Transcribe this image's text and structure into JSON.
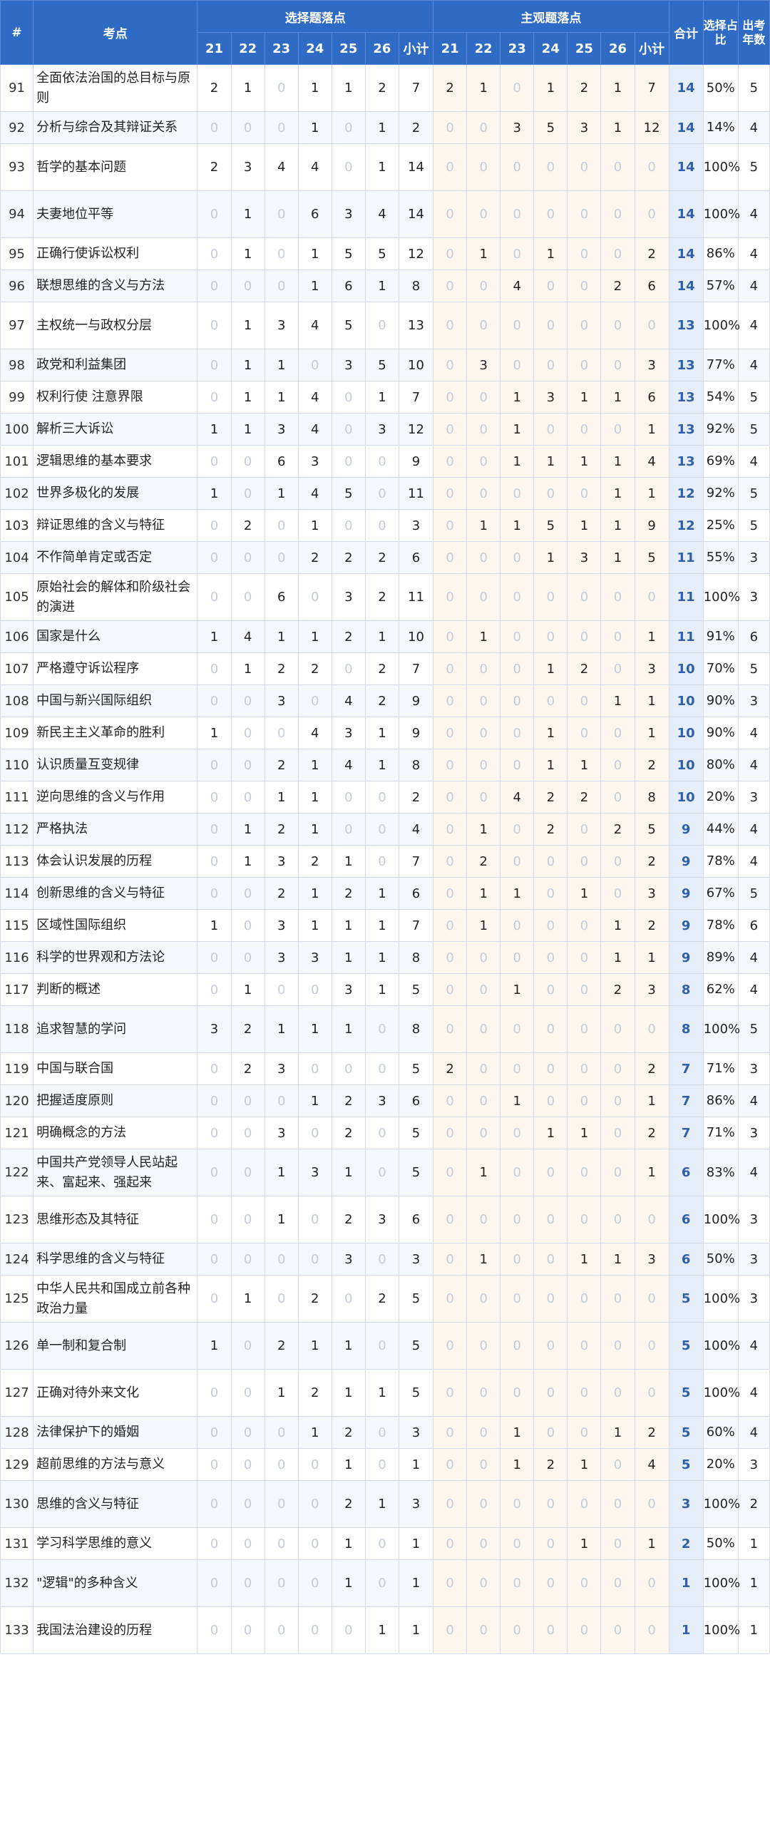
{
  "header": {
    "idx": "#",
    "topic": "考点",
    "objective_group": "选择题落点",
    "subjective_group": "主观题落点",
    "total": "合计",
    "ratio": "选择占比",
    "years": "出考年数",
    "year_cols": [
      "21",
      "22",
      "23",
      "24",
      "25",
      "26"
    ],
    "subtotal": "小计"
  },
  "rows": [
    {
      "no": "91",
      "topic": "全面依法治国的总目标与原则",
      "obj": [
        "2",
        "1",
        "0",
        "1",
        "1",
        "2"
      ],
      "obj_sub": "7",
      "subj": [
        "2",
        "1",
        "0",
        "1",
        "2",
        "1"
      ],
      "subj_sub": "7",
      "total": "14",
      "ratio": "50%",
      "years": "5"
    },
    {
      "no": "92",
      "topic": "分析与综合及其辩证关系",
      "obj": [
        "0",
        "0",
        "0",
        "1",
        "0",
        "1"
      ],
      "obj_sub": "2",
      "subj": [
        "0",
        "0",
        "3",
        "5",
        "3",
        "1"
      ],
      "subj_sub": "12",
      "total": "14",
      "ratio": "14%",
      "years": "4"
    },
    {
      "no": "93",
      "topic": "哲学的基本问题",
      "obj": [
        "2",
        "3",
        "4",
        "4",
        "0",
        "1"
      ],
      "obj_sub": "14",
      "subj": [
        "0",
        "0",
        "0",
        "0",
        "0",
        "0"
      ],
      "subj_sub": "0",
      "total": "14",
      "ratio": "100%",
      "years": "5"
    },
    {
      "no": "94",
      "topic": "夫妻地位平等",
      "obj": [
        "0",
        "1",
        "0",
        "6",
        "3",
        "4"
      ],
      "obj_sub": "14",
      "subj": [
        "0",
        "0",
        "0",
        "0",
        "0",
        "0"
      ],
      "subj_sub": "0",
      "total": "14",
      "ratio": "100%",
      "years": "4"
    },
    {
      "no": "95",
      "topic": "正确行使诉讼权利",
      "obj": [
        "0",
        "1",
        "0",
        "1",
        "5",
        "5"
      ],
      "obj_sub": "12",
      "subj": [
        "0",
        "1",
        "0",
        "1",
        "0",
        "0"
      ],
      "subj_sub": "2",
      "total": "14",
      "ratio": "86%",
      "years": "4"
    },
    {
      "no": "96",
      "topic": "联想思维的含义与方法",
      "obj": [
        "0",
        "0",
        "0",
        "1",
        "6",
        "1"
      ],
      "obj_sub": "8",
      "subj": [
        "0",
        "0",
        "4",
        "0",
        "0",
        "2"
      ],
      "subj_sub": "6",
      "total": "14",
      "ratio": "57%",
      "years": "4"
    },
    {
      "no": "97",
      "topic": "主权统一与政权分层",
      "obj": [
        "0",
        "1",
        "3",
        "4",
        "5",
        "0"
      ],
      "obj_sub": "13",
      "subj": [
        "0",
        "0",
        "0",
        "0",
        "0",
        "0"
      ],
      "subj_sub": "0",
      "total": "13",
      "ratio": "100%",
      "years": "4"
    },
    {
      "no": "98",
      "topic": "政党和利益集团",
      "obj": [
        "0",
        "1",
        "1",
        "0",
        "3",
        "5"
      ],
      "obj_sub": "10",
      "subj": [
        "0",
        "3",
        "0",
        "0",
        "0",
        "0"
      ],
      "subj_sub": "3",
      "total": "13",
      "ratio": "77%",
      "years": "4"
    },
    {
      "no": "99",
      "topic": "权利行使 注意界限",
      "obj": [
        "0",
        "1",
        "1",
        "4",
        "0",
        "1"
      ],
      "obj_sub": "7",
      "subj": [
        "0",
        "0",
        "1",
        "3",
        "1",
        "1"
      ],
      "subj_sub": "6",
      "total": "13",
      "ratio": "54%",
      "years": "5"
    },
    {
      "no": "100",
      "topic": "解析三大诉讼",
      "obj": [
        "1",
        "1",
        "3",
        "4",
        "0",
        "3"
      ],
      "obj_sub": "12",
      "subj": [
        "0",
        "0",
        "1",
        "0",
        "0",
        "0"
      ],
      "subj_sub": "1",
      "total": "13",
      "ratio": "92%",
      "years": "5"
    },
    {
      "no": "101",
      "topic": "逻辑思维的基本要求",
      "obj": [
        "0",
        "0",
        "6",
        "3",
        "0",
        "0"
      ],
      "obj_sub": "9",
      "subj": [
        "0",
        "0",
        "1",
        "1",
        "1",
        "1"
      ],
      "subj_sub": "4",
      "total": "13",
      "ratio": "69%",
      "years": "4"
    },
    {
      "no": "102",
      "topic": "世界多极化的发展",
      "obj": [
        "1",
        "0",
        "1",
        "4",
        "5",
        "0"
      ],
      "obj_sub": "11",
      "subj": [
        "0",
        "0",
        "0",
        "0",
        "0",
        "1"
      ],
      "subj_sub": "1",
      "total": "12",
      "ratio": "92%",
      "years": "5"
    },
    {
      "no": "103",
      "topic": "辩证思维的含义与特征",
      "obj": [
        "0",
        "2",
        "0",
        "1",
        "0",
        "0"
      ],
      "obj_sub": "3",
      "subj": [
        "0",
        "1",
        "1",
        "5",
        "1",
        "1"
      ],
      "subj_sub": "9",
      "total": "12",
      "ratio": "25%",
      "years": "5"
    },
    {
      "no": "104",
      "topic": "不作简单肯定或否定",
      "obj": [
        "0",
        "0",
        "0",
        "2",
        "2",
        "2"
      ],
      "obj_sub": "6",
      "subj": [
        "0",
        "0",
        "0",
        "1",
        "3",
        "1"
      ],
      "subj_sub": "5",
      "total": "11",
      "ratio": "55%",
      "years": "3"
    },
    {
      "no": "105",
      "topic": "原始社会的解体和阶级社会的演进",
      "obj": [
        "0",
        "0",
        "6",
        "0",
        "3",
        "2"
      ],
      "obj_sub": "11",
      "subj": [
        "0",
        "0",
        "0",
        "0",
        "0",
        "0"
      ],
      "subj_sub": "0",
      "total": "11",
      "ratio": "100%",
      "years": "3"
    },
    {
      "no": "106",
      "topic": "国家是什么",
      "obj": [
        "1",
        "4",
        "1",
        "1",
        "2",
        "1"
      ],
      "obj_sub": "10",
      "subj": [
        "0",
        "1",
        "0",
        "0",
        "0",
        "0"
      ],
      "subj_sub": "1",
      "total": "11",
      "ratio": "91%",
      "years": "6"
    },
    {
      "no": "107",
      "topic": "严格遵守诉讼程序",
      "obj": [
        "0",
        "1",
        "2",
        "2",
        "0",
        "2"
      ],
      "obj_sub": "7",
      "subj": [
        "0",
        "0",
        "0",
        "1",
        "2",
        "0"
      ],
      "subj_sub": "3",
      "total": "10",
      "ratio": "70%",
      "years": "5"
    },
    {
      "no": "108",
      "topic": "中国与新兴国际组织",
      "obj": [
        "0",
        "0",
        "3",
        "0",
        "4",
        "2"
      ],
      "obj_sub": "9",
      "subj": [
        "0",
        "0",
        "0",
        "0",
        "0",
        "1"
      ],
      "subj_sub": "1",
      "total": "10",
      "ratio": "90%",
      "years": "3"
    },
    {
      "no": "109",
      "topic": "新民主主义革命的胜利",
      "obj": [
        "1",
        "0",
        "0",
        "4",
        "3",
        "1"
      ],
      "obj_sub": "9",
      "subj": [
        "0",
        "0",
        "0",
        "1",
        "0",
        "0"
      ],
      "subj_sub": "1",
      "total": "10",
      "ratio": "90%",
      "years": "4"
    },
    {
      "no": "110",
      "topic": "认识质量互变规律",
      "obj": [
        "0",
        "0",
        "2",
        "1",
        "4",
        "1"
      ],
      "obj_sub": "8",
      "subj": [
        "0",
        "0",
        "0",
        "1",
        "1",
        "0"
      ],
      "subj_sub": "2",
      "total": "10",
      "ratio": "80%",
      "years": "4"
    },
    {
      "no": "111",
      "topic": "逆向思维的含义与作用",
      "obj": [
        "0",
        "0",
        "1",
        "1",
        "0",
        "0"
      ],
      "obj_sub": "2",
      "subj": [
        "0",
        "0",
        "4",
        "2",
        "2",
        "0"
      ],
      "subj_sub": "8",
      "total": "10",
      "ratio": "20%",
      "years": "3"
    },
    {
      "no": "112",
      "topic": "严格执法",
      "obj": [
        "0",
        "1",
        "2",
        "1",
        "0",
        "0"
      ],
      "obj_sub": "4",
      "subj": [
        "0",
        "1",
        "0",
        "2",
        "0",
        "2"
      ],
      "subj_sub": "5",
      "total": "9",
      "ratio": "44%",
      "years": "4"
    },
    {
      "no": "113",
      "topic": "体会认识发展的历程",
      "obj": [
        "0",
        "1",
        "3",
        "2",
        "1",
        "0"
      ],
      "obj_sub": "7",
      "subj": [
        "0",
        "2",
        "0",
        "0",
        "0",
        "0"
      ],
      "subj_sub": "2",
      "total": "9",
      "ratio": "78%",
      "years": "4"
    },
    {
      "no": "114",
      "topic": "创新思维的含义与特征",
      "obj": [
        "0",
        "0",
        "2",
        "1",
        "2",
        "1"
      ],
      "obj_sub": "6",
      "subj": [
        "0",
        "1",
        "1",
        "0",
        "1",
        "0"
      ],
      "subj_sub": "3",
      "total": "9",
      "ratio": "67%",
      "years": "5"
    },
    {
      "no": "115",
      "topic": "区域性国际组织",
      "obj": [
        "1",
        "0",
        "3",
        "1",
        "1",
        "1"
      ],
      "obj_sub": "7",
      "subj": [
        "0",
        "1",
        "0",
        "0",
        "0",
        "1"
      ],
      "subj_sub": "2",
      "total": "9",
      "ratio": "78%",
      "years": "6"
    },
    {
      "no": "116",
      "topic": "科学的世界观和方法论",
      "obj": [
        "0",
        "0",
        "3",
        "3",
        "1",
        "1"
      ],
      "obj_sub": "8",
      "subj": [
        "0",
        "0",
        "0",
        "0",
        "0",
        "1"
      ],
      "subj_sub": "1",
      "total": "9",
      "ratio": "89%",
      "years": "4"
    },
    {
      "no": "117",
      "topic": "判断的概述",
      "obj": [
        "0",
        "1",
        "0",
        "0",
        "3",
        "1"
      ],
      "obj_sub": "5",
      "subj": [
        "0",
        "0",
        "1",
        "0",
        "0",
        "2"
      ],
      "subj_sub": "3",
      "total": "8",
      "ratio": "62%",
      "years": "4"
    },
    {
      "no": "118",
      "topic": "追求智慧的学问",
      "obj": [
        "3",
        "2",
        "1",
        "1",
        "1",
        "0"
      ],
      "obj_sub": "8",
      "subj": [
        "0",
        "0",
        "0",
        "0",
        "0",
        "0"
      ],
      "subj_sub": "0",
      "total": "8",
      "ratio": "100%",
      "years": "5"
    },
    {
      "no": "119",
      "topic": "中国与联合国",
      "obj": [
        "0",
        "2",
        "3",
        "0",
        "0",
        "0"
      ],
      "obj_sub": "5",
      "subj": [
        "2",
        "0",
        "0",
        "0",
        "0",
        "0"
      ],
      "subj_sub": "2",
      "total": "7",
      "ratio": "71%",
      "years": "3"
    },
    {
      "no": "120",
      "topic": "把握适度原则",
      "obj": [
        "0",
        "0",
        "0",
        "1",
        "2",
        "3"
      ],
      "obj_sub": "6",
      "subj": [
        "0",
        "0",
        "1",
        "0",
        "0",
        "0"
      ],
      "subj_sub": "1",
      "total": "7",
      "ratio": "86%",
      "years": "4"
    },
    {
      "no": "121",
      "topic": "明确概念的方法",
      "obj": [
        "0",
        "0",
        "3",
        "0",
        "2",
        "0"
      ],
      "obj_sub": "5",
      "subj": [
        "0",
        "0",
        "0",
        "1",
        "1",
        "0"
      ],
      "subj_sub": "2",
      "total": "7",
      "ratio": "71%",
      "years": "3"
    },
    {
      "no": "122",
      "topic": "中国共产党领导人民站起来、富起来、强起来",
      "obj": [
        "0",
        "0",
        "1",
        "3",
        "1",
        "0"
      ],
      "obj_sub": "5",
      "subj": [
        "0",
        "1",
        "0",
        "0",
        "0",
        "0"
      ],
      "subj_sub": "1",
      "total": "6",
      "ratio": "83%",
      "years": "4"
    },
    {
      "no": "123",
      "topic": "思维形态及其特征",
      "obj": [
        "0",
        "0",
        "1",
        "0",
        "2",
        "3"
      ],
      "obj_sub": "6",
      "subj": [
        "0",
        "0",
        "0",
        "0",
        "0",
        "0"
      ],
      "subj_sub": "0",
      "total": "6",
      "ratio": "100%",
      "years": "3"
    },
    {
      "no": "124",
      "topic": "科学思维的含义与特征",
      "obj": [
        "0",
        "0",
        "0",
        "0",
        "3",
        "0"
      ],
      "obj_sub": "3",
      "subj": [
        "0",
        "1",
        "0",
        "0",
        "1",
        "1"
      ],
      "subj_sub": "3",
      "total": "6",
      "ratio": "50%",
      "years": "3"
    },
    {
      "no": "125",
      "topic": "中华人民共和国成立前各种政治力量",
      "obj": [
        "0",
        "1",
        "0",
        "2",
        "0",
        "2"
      ],
      "obj_sub": "5",
      "subj": [
        "0",
        "0",
        "0",
        "0",
        "0",
        "0"
      ],
      "subj_sub": "0",
      "total": "5",
      "ratio": "100%",
      "years": "3"
    },
    {
      "no": "126",
      "topic": "单一制和复合制",
      "obj": [
        "1",
        "0",
        "2",
        "1",
        "1",
        "0"
      ],
      "obj_sub": "5",
      "subj": [
        "0",
        "0",
        "0",
        "0",
        "0",
        "0"
      ],
      "subj_sub": "0",
      "total": "5",
      "ratio": "100%",
      "years": "4"
    },
    {
      "no": "127",
      "topic": "正确对待外来文化",
      "obj": [
        "0",
        "0",
        "1",
        "2",
        "1",
        "1"
      ],
      "obj_sub": "5",
      "subj": [
        "0",
        "0",
        "0",
        "0",
        "0",
        "0"
      ],
      "subj_sub": "0",
      "total": "5",
      "ratio": "100%",
      "years": "4"
    },
    {
      "no": "128",
      "topic": "法律保护下的婚姻",
      "obj": [
        "0",
        "0",
        "0",
        "1",
        "2",
        "0"
      ],
      "obj_sub": "3",
      "subj": [
        "0",
        "0",
        "1",
        "0",
        "0",
        "1"
      ],
      "subj_sub": "2",
      "total": "5",
      "ratio": "60%",
      "years": "4"
    },
    {
      "no": "129",
      "topic": "超前思维的方法与意义",
      "obj": [
        "0",
        "0",
        "0",
        "0",
        "1",
        "0"
      ],
      "obj_sub": "1",
      "subj": [
        "0",
        "0",
        "1",
        "2",
        "1",
        "0"
      ],
      "subj_sub": "4",
      "total": "5",
      "ratio": "20%",
      "years": "3"
    },
    {
      "no": "130",
      "topic": "思维的含义与特征",
      "obj": [
        "0",
        "0",
        "0",
        "0",
        "2",
        "1"
      ],
      "obj_sub": "3",
      "subj": [
        "0",
        "0",
        "0",
        "0",
        "0",
        "0"
      ],
      "subj_sub": "0",
      "total": "3",
      "ratio": "100%",
      "years": "2"
    },
    {
      "no": "131",
      "topic": "学习科学思维的意义",
      "obj": [
        "0",
        "0",
        "0",
        "0",
        "1",
        "0"
      ],
      "obj_sub": "1",
      "subj": [
        "0",
        "0",
        "0",
        "0",
        "1",
        "0"
      ],
      "subj_sub": "1",
      "total": "2",
      "ratio": "50%",
      "years": "1"
    },
    {
      "no": "132",
      "topic": "\"逻辑\"的多种含义",
      "obj": [
        "0",
        "0",
        "0",
        "0",
        "1",
        "0"
      ],
      "obj_sub": "1",
      "subj": [
        "0",
        "0",
        "0",
        "0",
        "0",
        "0"
      ],
      "subj_sub": "0",
      "total": "1",
      "ratio": "100%",
      "years": "1"
    },
    {
      "no": "133",
      "topic": "我国法治建设的历程",
      "obj": [
        "0",
        "0",
        "0",
        "0",
        "0",
        "1"
      ],
      "obj_sub": "1",
      "subj": [
        "0",
        "0",
        "0",
        "0",
        "0",
        "0"
      ],
      "subj_sub": "0",
      "total": "1",
      "ratio": "100%",
      "years": "1"
    }
  ]
}
